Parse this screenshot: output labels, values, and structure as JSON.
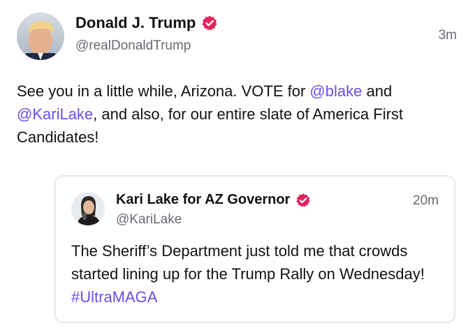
{
  "colors": {
    "accent": "#6b4de6",
    "verified_badge": "#e0245e",
    "secondary_text": "#666b72",
    "border": "#e6e7ea"
  },
  "post": {
    "author": {
      "display_name": "Donald J. Trump",
      "handle": "@realDonaldTrump",
      "verified_icon": "verified-badge-icon"
    },
    "timestamp": "3m",
    "body": {
      "text1": "See you in a little while, Arizona. VOTE for ",
      "mention1": "@blake",
      "text2": " and ",
      "mention2": "@KariLake",
      "text3": ", and also, for our entire slate of America First Candidates!"
    },
    "quote": {
      "author": {
        "display_name": "Kari Lake for AZ Governor",
        "handle": "@KariLake",
        "verified_icon": "verified-badge-icon"
      },
      "timestamp": "20m",
      "body": {
        "text1": "The Sheriff’s Department just told me that crowds started lining up for the Trump Rally on Wednesday! ",
        "hashtag": "#UltraMAGA"
      }
    }
  }
}
